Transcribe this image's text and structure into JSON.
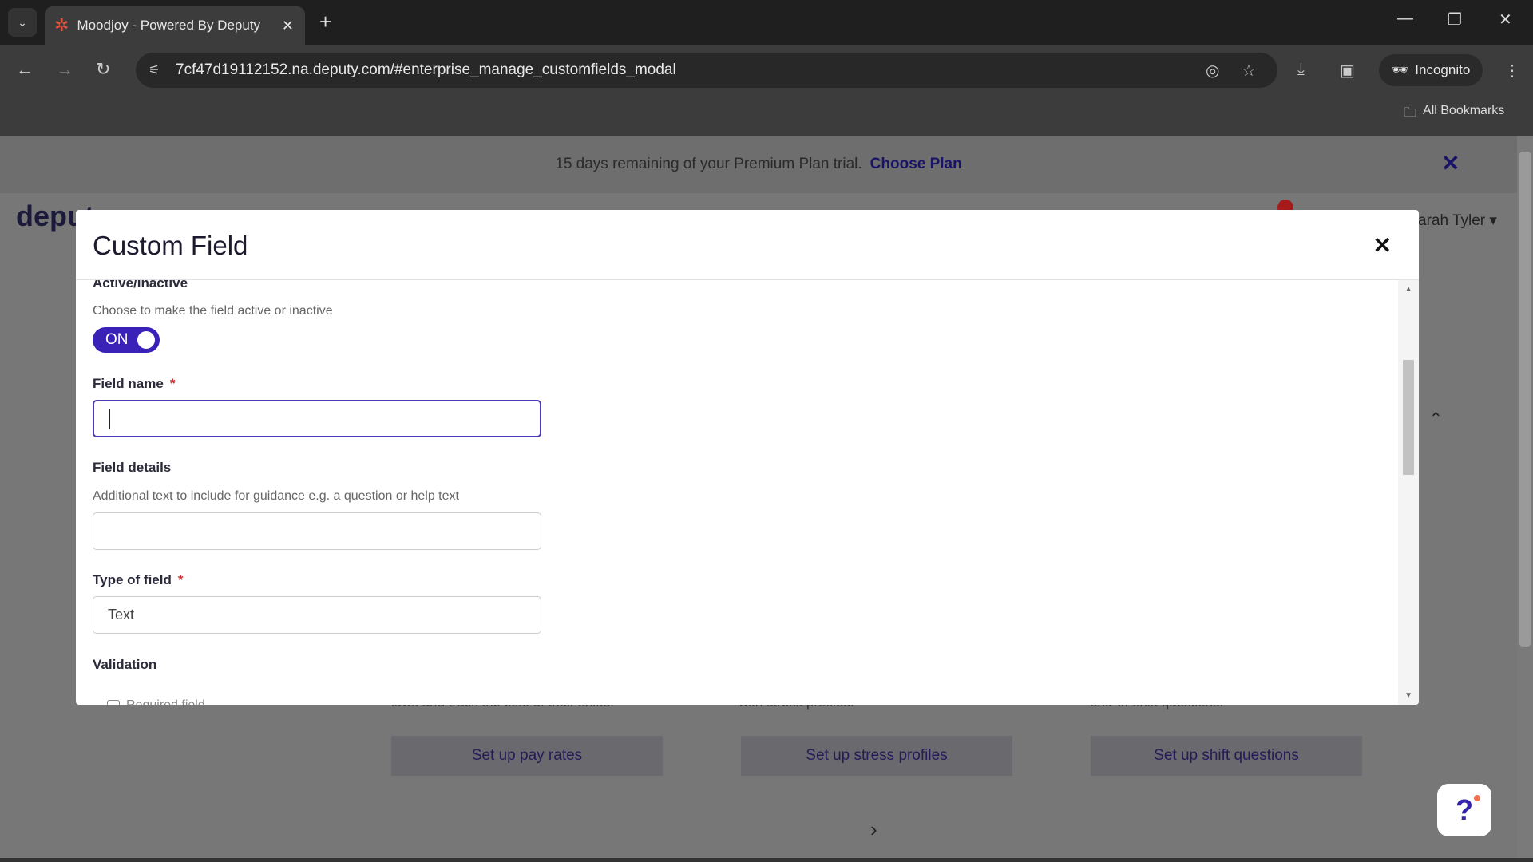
{
  "browser": {
    "tab_title": "Moodjoy - Powered By Deputy",
    "url": "7cf47d19112152.na.deputy.com/#enterprise_manage_customfields_modal",
    "incognito_label": "Incognito",
    "bookmarks_label": "All Bookmarks"
  },
  "banner": {
    "text": "15 days remaining of your Premium Plan trial.",
    "link": "Choose Plan"
  },
  "app": {
    "logo": "deputy",
    "user": "arah Tyler",
    "notification_count": "1"
  },
  "background": {
    "cards": [
      {
        "text": "laws and track the cost of their shifts.",
        "button": "Set up pay rates"
      },
      {
        "text": "with stress profiles.",
        "button": "Set up stress profiles"
      },
      {
        "text": "end-of-shift questions.",
        "button": "Set up shift questions"
      }
    ]
  },
  "modal": {
    "title": "Custom Field",
    "active": {
      "label": "Active/Inactive",
      "description": "Choose to make the field active or inactive",
      "toggle_label": "ON",
      "value": true
    },
    "field_name": {
      "label": "Field name",
      "required_mark": "*",
      "value": ""
    },
    "field_details": {
      "label": "Field details",
      "description": "Additional text to include for guidance e.g. a question or help text",
      "value": ""
    },
    "type_of_field": {
      "label": "Type of field",
      "required_mark": "*",
      "value": "Text"
    },
    "validation": {
      "label": "Validation",
      "checkbox_label": "Required field"
    }
  },
  "colors": {
    "accent": "#3a22b8",
    "link": "#1a1466",
    "required": "#d03030"
  }
}
